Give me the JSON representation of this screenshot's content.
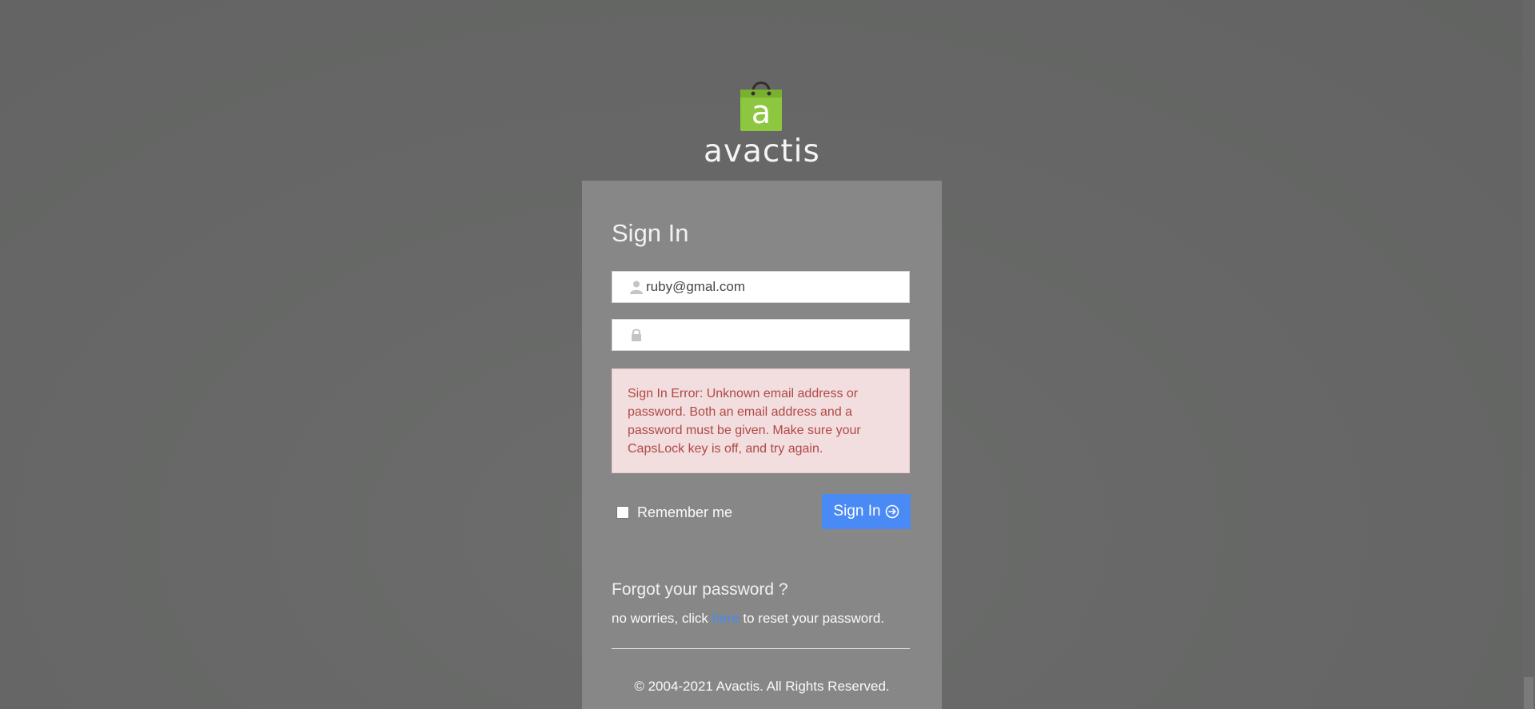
{
  "brand": {
    "name": "avactis",
    "accent_color": "#8dc63f"
  },
  "signin": {
    "title": "Sign In",
    "email_value": "ruby@gmal.com",
    "password_value": "",
    "error_message": "Sign In Error: Unknown email address or password. Both an email address and a password must be given. Make sure your CapsLock key is off, and try again.",
    "remember_label": "Remember me",
    "remember_checked": false,
    "button_label": "Sign In",
    "button_color": "#4a8af4"
  },
  "forgot": {
    "title": "Forgot your password ?",
    "text_before": "no worries, click ",
    "link_text": "here",
    "text_after": " to reset your password."
  },
  "footer": {
    "copyright": "© 2004-2021 Avactis. All Rights Reserved."
  },
  "icons": {
    "email": "user-icon",
    "password": "lock-icon",
    "button": "arrow-circle-right-icon"
  }
}
